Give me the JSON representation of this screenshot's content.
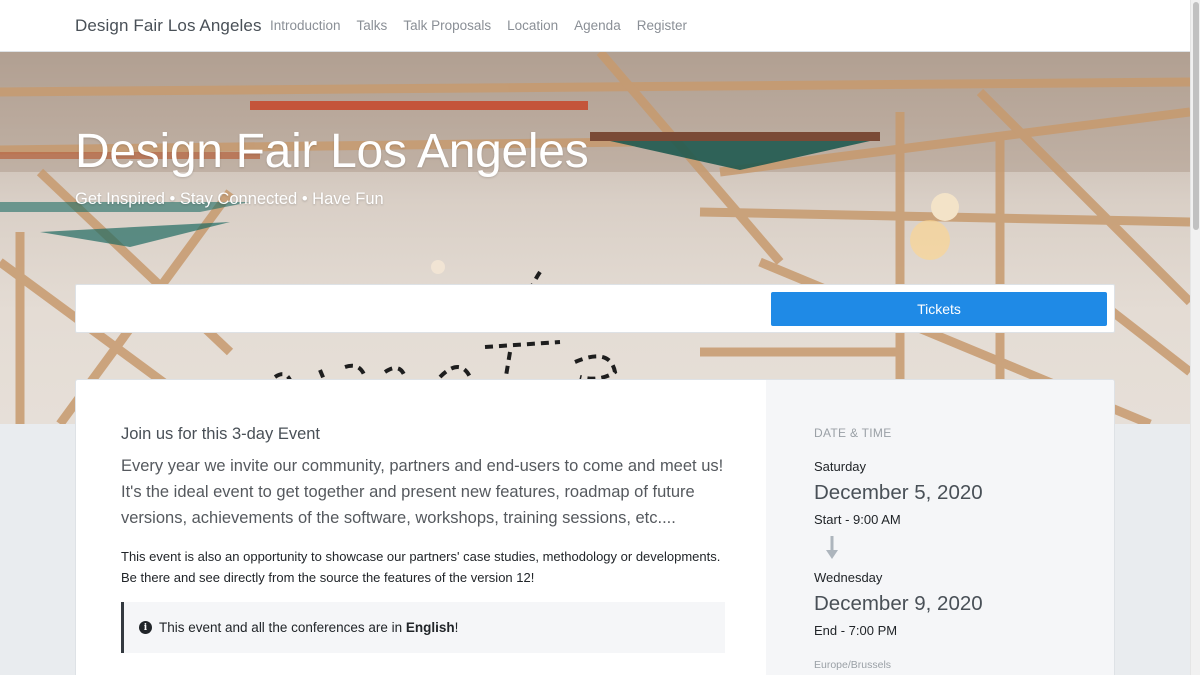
{
  "navbar": {
    "brand": "Design Fair Los Angeles",
    "links": [
      "Introduction",
      "Talks",
      "Talk Proposals",
      "Location",
      "Agenda",
      "Register"
    ]
  },
  "hero": {
    "title": "Design Fair Los Angeles",
    "subtitle": "Get Inspired • Stay Connected • Have Fun"
  },
  "tickets": {
    "label": "Tickets"
  },
  "intro": {
    "title": "Join us for this 3-day Event",
    "lead": "Every year we invite our community, partners and end-users to come and meet us! It's the ideal event to get together and present new features, roadmap of future versions, achievements of the software, workshops, training sessions, etc....",
    "body": "This event is also an opportunity to showcase our partners' case studies, methodology or developments. Be there and see directly from the source the features of the version 12!",
    "notice_prefix": "This event and all the conferences are in ",
    "notice_language": "English",
    "notice_suffix": "!"
  },
  "datetime": {
    "heading": "DATE & TIME",
    "start_day": "Saturday",
    "start_date": "December 5, 2020",
    "start_time": "Start - 9:00 AM",
    "end_day": "Wednesday",
    "end_date": "December 9, 2020",
    "end_time": "End - 7:00 PM",
    "timezone": "Europe/Brussels"
  },
  "colors": {
    "accent": "#1f8ae6",
    "brand_text": "#495057"
  },
  "icons": {
    "notice": "info-circle-icon",
    "range": "arrow-down-icon"
  }
}
